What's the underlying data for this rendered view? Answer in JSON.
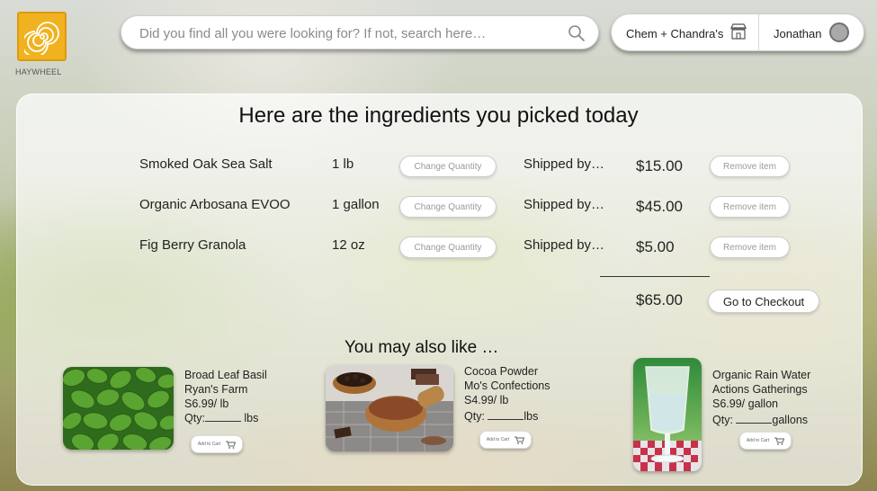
{
  "brand": {
    "name": "HAYWHEEL",
    "logo_color": "#f1b21f"
  },
  "search": {
    "placeholder": "Did you find all you were looking for? If not, search here…",
    "value": ""
  },
  "store": {
    "name": "Chem + Chandra's",
    "user": "Jonathan"
  },
  "cart": {
    "title": "Here are the ingredients you picked today",
    "items": [
      {
        "name": "Smoked Oak Sea Salt",
        "qty": "1 lb",
        "change_label": "Change Quantity",
        "shipped": "Shipped by…",
        "price": "$15.00",
        "remove_label": "Remove item"
      },
      {
        "name": "Organic Arbosana EVOO",
        "qty": "1 gallon",
        "change_label": "Change Quantity",
        "shipped": "Shipped by…",
        "price": "$45.00",
        "remove_label": "Remove item"
      },
      {
        "name": "Fig Berry Granola",
        "qty": "12 oz",
        "change_label": "Change Quantity",
        "shipped": "Shipped by…",
        "price": "$5.00",
        "remove_label": "Remove item"
      }
    ],
    "total": "$65.00",
    "checkout_label": "Go to Checkout"
  },
  "recommendations": {
    "title": "You may also like …",
    "items": [
      {
        "name": "Broad Leaf Basil",
        "seller": "Ryan's Farm",
        "price": "S6.99/ lb",
        "qty_label": "Qty:",
        "unit": "lbs",
        "add_label": "Add to Cart",
        "image": "basil-leaves"
      },
      {
        "name": "Cocoa Powder",
        "seller": "Mo's Confections",
        "price": "S4.99/ lb",
        "qty_label": "Qty:",
        "unit": "lbs",
        "add_label": "Add to Cart",
        "image": "cocoa-bowls"
      },
      {
        "name": "Organic Rain Water",
        "seller": "Actions Gatherings",
        "price": "S6.99/ gallon",
        "qty_label": "Qty:",
        "unit": "gallons",
        "add_label": "Add to Cart",
        "image": "water-glass"
      }
    ]
  }
}
